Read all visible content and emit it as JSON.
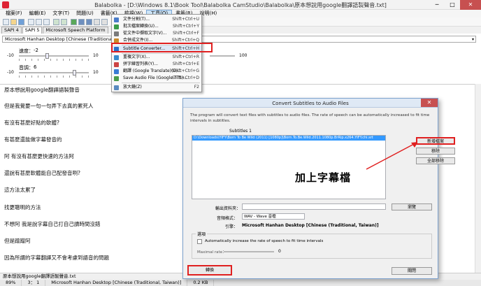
{
  "window": {
    "title": "Balabolka - [D:\\Windows 8.1\\Book Tool\\Balabolka CamStudio\\Balabolka\\原本想說用google翻譯語製聲音.txt]",
    "min": "─",
    "max": "□",
    "close": "✕"
  },
  "menubar": [
    "檔案(F)",
    "編輯(E)",
    "文字(T)",
    "問題(U)",
    "書籤(K)",
    "檢視(W)",
    "工具(O)",
    "書籤(R)",
    "說明(H)"
  ],
  "tabs": [
    "SAPI 4",
    "SAPI 5",
    "Microsoft Speech Platform"
  ],
  "voice": "Microsoft Hanhan Desktop [Chinese (Traditional, Taiwan)]",
  "sliders": {
    "rate_label": "速度：",
    "rate_value": "-2",
    "rate_min": "-10",
    "rate_max": "10",
    "pitch_label": "音調：",
    "pitch_value": "6",
    "pitch_min": "-10",
    "pitch_max": "10",
    "volume_max": "100"
  },
  "text_lines": [
    "原本想說用google翻譯語製聲音",
    "但是我覺要一句一句弄下去真的累死人",
    "有沒有甚麼好點的軟體?",
    "有甚麼還能做字幕發音的",
    "阿 有沒有甚麼更快速的方法阿",
    "還說有甚麼軟體能自己配發音咧?",
    "這方法太累了",
    "找更聰明的方法",
    "不想阿 我是說字幕自己打自己讀時間沒錯",
    "但是蹭蹭阿",
    "因為所謂的字幕翻譯又不會考慮到語音的問題"
  ],
  "tools_menu": {
    "items": [
      {
        "label": "文件分割(T)...",
        "key": "Shift+Ctrl+U",
        "icon": "split-icon",
        "color": "#4a7cc9"
      },
      {
        "label": "批次檔案轉換(U)...",
        "key": "Shift+Ctrl+Y",
        "icon": "batch-icon",
        "color": "#3a9c4a"
      },
      {
        "label": "從文件中擷取文字(V)...",
        "key": "Shift+Ctrl+F",
        "icon": "extract-icon",
        "color": "#7b7b7b"
      },
      {
        "label": "合併成文件(I)...",
        "key": "Shift+Ctrl+Q",
        "icon": "merge-icon",
        "color": "#c98b2a"
      },
      {
        "label": "Subtitle Converter...",
        "key": "Shift+Ctrl+H",
        "icon": "subtitle-icon",
        "color": "#2a6fc9"
      },
      {
        "label": "重複文字(X)...",
        "key": "Shift+Ctrl+R",
        "icon": "repeat-icon",
        "color": "#3a8ccd"
      },
      {
        "label": "拼字練習列表(Y)...",
        "key": "Shift+Ctrl+E",
        "icon": "spelling-icon",
        "color": "#cc4444"
      },
      {
        "label": "翻譯 (Google Translate)(G)...",
        "key": "Shift+Ctrl+G",
        "icon": "translate-icon",
        "color": "#3a7bd5"
      },
      {
        "label": "Save Audio File (Google TTS)...",
        "key": "Shift+Ctrl+D",
        "icon": "audio-icon",
        "color": "#4a9c4a"
      },
      {
        "label": "放大鏡(Z)",
        "key": "F2",
        "icon": "magnifier-icon",
        "color": "#5a8ac0"
      }
    ]
  },
  "dialog": {
    "title": "Convert Subtitles to Audio Files",
    "description": "The program will convert text files with subtitles to audio files. The rate of speech can be automatically increased to fit time intervals in subtitles.",
    "subtitles_label": "Subtitles 1",
    "file_entry": "D:\\Downloads\\YIFY\\Born To Be Wild (2011) [1080p]\\Born.To.Be.Wild.2011.1080p.BrRip.x264.YIFY.chi.srt",
    "annotation": "加上字幕檔",
    "add_button": "新增檔案",
    "remove_button": "移除",
    "remove_all_button": "全部移除",
    "output_label": "輸出資料夾：",
    "browse_button": "瀏覽",
    "format_label": "音頻格式：",
    "format_value": "WAV - Wave 音檔",
    "engine_label": "引擎：",
    "engine_value": "Microsoft Hanhan Desktop [Chinese (Traditional, Taiwan)]",
    "options_label": "選項",
    "auto_label": "Automatically increase the rate of speech to fit time intervals",
    "maxrate_label": "Maximal rate：",
    "maxrate_value": "0",
    "convert_button": "轉換",
    "close_button": "關閉"
  },
  "doc_tab": "原本想說用google翻譯語製聲音.txt",
  "status": [
    "89%",
    "3： 1",
    "Microsoft Hanhan Desktop [Chinese (Traditional, Taiwan)]",
    "0.2 KB"
  ],
  "colors": {
    "highlight": "#e02020",
    "selection": "#3399ff",
    "accent": "#dfe9f5"
  }
}
